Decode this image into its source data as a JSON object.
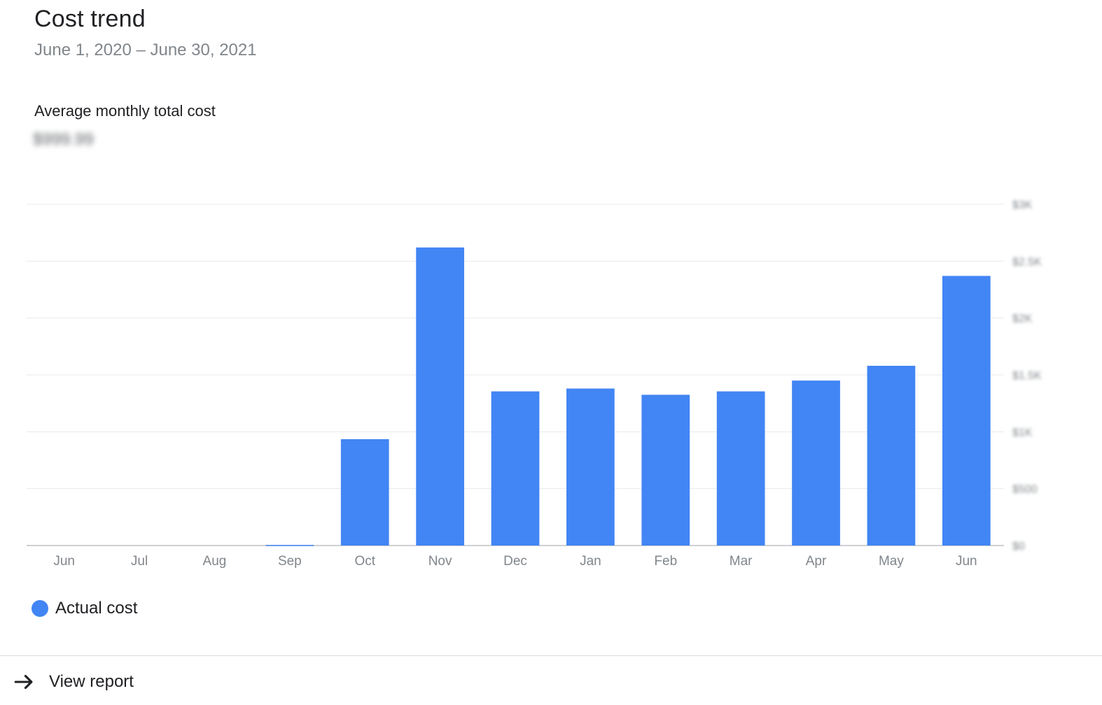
{
  "card": {
    "title": "Cost trend",
    "date_range": "June 1, 2020 – June 30, 2021",
    "metric_label": "Average monthly total cost",
    "metric_value": "$999.99"
  },
  "legend": {
    "label": "Actual cost"
  },
  "footer": {
    "link_label": "View report"
  },
  "colors": {
    "accent": "#4285f4",
    "grid": "#e8eaed",
    "axis_text": "#80868b"
  },
  "chart_data": {
    "type": "bar",
    "title": "Cost trend",
    "categories": [
      "Jun",
      "Jul",
      "Aug",
      "Sep",
      "Oct",
      "Nov",
      "Dec",
      "Jan",
      "Feb",
      "Mar",
      "Apr",
      "May",
      "Jun"
    ],
    "series": [
      {
        "name": "Actual cost",
        "values": [
          0,
          0,
          0,
          5,
          935,
          2620,
          1355,
          1380,
          1325,
          1355,
          1450,
          1580,
          2370
        ]
      }
    ],
    "ylim": [
      0,
      3000
    ],
    "y_ticks": [
      0,
      500,
      1000,
      1500,
      2000,
      2500,
      3000
    ],
    "y_tick_labels": [
      "$0",
      "$500",
      "$1K",
      "$1.5K",
      "$2K",
      "$2.5K",
      "$3K"
    ],
    "y_axis_side": "right",
    "grid": true,
    "legend_position": "bottom-left",
    "xlabel": "",
    "ylabel": ""
  }
}
